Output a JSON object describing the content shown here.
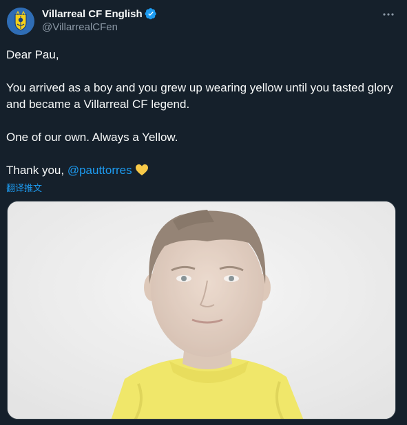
{
  "author": {
    "display_name": "Villarreal CF English",
    "handle": "@VillarrealCFen",
    "verified": true,
    "avatar_icon": "villarreal-crest-icon"
  },
  "tweet": {
    "line1": "Dear Pau,",
    "line2": "You arrived as a boy and you grew up wearing yellow until you tasted glory and became a Villarreal CF legend.",
    "line3": "One of our own. Always a Yellow.",
    "line4_prefix": "Thank you, ",
    "mention": "@pauttorres",
    "emoji": "yellow-heart-icon"
  },
  "translate_label": "翻译推文",
  "colors": {
    "background": "#15202b",
    "text": "#f7f9f9",
    "secondary_text": "#8b98a5",
    "link": "#1d9bf0",
    "verified_badge": "#1d9bf0",
    "heart": "#f7c948"
  },
  "media": {
    "description_icon": "photo-boy-yellow-shirt"
  }
}
